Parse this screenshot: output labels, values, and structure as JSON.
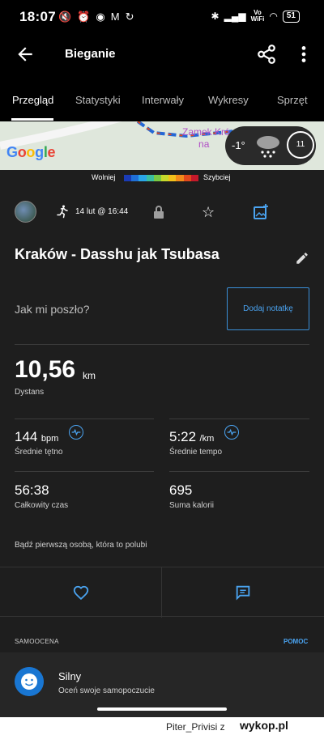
{
  "status": {
    "time": "18:07",
    "battery": "51",
    "vowifi_top": "Vo",
    "vowifi_bottom": "WiFi"
  },
  "appbar": {
    "title": "Bieganie"
  },
  "tabs": [
    "Przegląd",
    "Statystyki",
    "Interwały",
    "Wykresy",
    "Sprzęt"
  ],
  "map": {
    "logo": "Google",
    "place_line1": "Zamek Kró",
    "place_line2": "na",
    "temperature": "-1°",
    "wind": "11"
  },
  "legend": {
    "slow": "Wolniej",
    "fast": "Szybciej",
    "colors": [
      "#1a3bb5",
      "#1f6fd6",
      "#2aa6e8",
      "#3bbfa0",
      "#7ac943",
      "#c6d92b",
      "#f2c01a",
      "#f28a1a",
      "#e2491c",
      "#c6192a"
    ]
  },
  "activity": {
    "date": "14 lut @ 16:44",
    "title": "Kraków - Dasshu jak Tsubasa",
    "feel_prompt": "Jak mi poszło?",
    "add_note": "Dodaj notatkę"
  },
  "distance": {
    "value": "10,56",
    "unit": "km",
    "label": "Dystans"
  },
  "metrics": [
    {
      "value": "144",
      "unit": "bpm",
      "label": "Średnie tętno"
    },
    {
      "value": "5:22",
      "unit": "/km",
      "label": "Średnie tempo"
    },
    {
      "value": "56:38",
      "unit": "",
      "label": "Całkowity czas"
    },
    {
      "value": "695",
      "unit": "",
      "label": "Suma kalorii"
    }
  ],
  "social": {
    "like_text": "Bądź pierwszą osobą, która to polubi"
  },
  "self_assessment": {
    "label": "SAMOOCENA",
    "help": "POMOC",
    "title": "Silny",
    "subtitle": "Oceń swoje samopoczucie"
  },
  "watermark": {
    "user": "Piter_Privisi z",
    "site": "wykop.pl"
  }
}
